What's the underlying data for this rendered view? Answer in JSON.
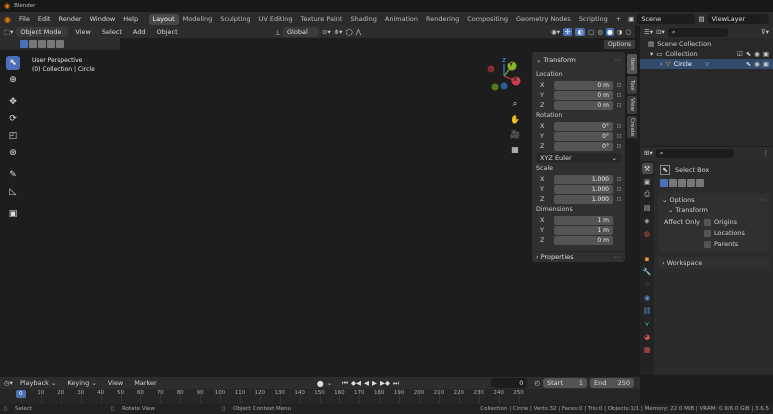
{
  "window": {
    "title": "Blender"
  },
  "menus": [
    "File",
    "Edit",
    "Render",
    "Window",
    "Help"
  ],
  "workspaces": [
    "Layout",
    "Modeling",
    "Sculpting",
    "UV Editing",
    "Texture Paint",
    "Shading",
    "Animation",
    "Rendering",
    "Compositing",
    "Geometry Nodes",
    "Scripting"
  ],
  "active_workspace": "Layout",
  "add_workspace": "+",
  "scene": {
    "name": "Scene",
    "view_layer": "ViewLayer"
  },
  "viewport_header": {
    "mode": "Object Mode",
    "menus": [
      "View",
      "Select",
      "Add",
      "Object"
    ],
    "transform_orientation": "Global",
    "options_label": "Options"
  },
  "viewport": {
    "view_name": "User Perspective",
    "collection_info": "(0) Collection | Circle",
    "gizmo": {
      "x": "X",
      "y": "Y",
      "z": "Z"
    }
  },
  "n_tabs": [
    "Item",
    "Tool",
    "View",
    "Create"
  ],
  "transform": {
    "title": "Transform",
    "location_label": "Location",
    "location": [
      {
        "axis": "X",
        "value": "0 m"
      },
      {
        "axis": "Y",
        "value": "0 m"
      },
      {
        "axis": "Z",
        "value": "0 m"
      }
    ],
    "rotation_label": "Rotation",
    "rotation": [
      {
        "axis": "X",
        "value": "0°"
      },
      {
        "axis": "Y",
        "value": "0°"
      },
      {
        "axis": "Z",
        "value": "0°"
      }
    ],
    "rotation_mode": "XYZ Euler",
    "scale_label": "Scale",
    "scale": [
      {
        "axis": "X",
        "value": "1.000"
      },
      {
        "axis": "Y",
        "value": "1.000"
      },
      {
        "axis": "Z",
        "value": "1.000"
      }
    ],
    "dimensions_label": "Dimensions",
    "dimensions": [
      {
        "axis": "X",
        "value": "1 m"
      },
      {
        "axis": "Y",
        "value": "1 m"
      },
      {
        "axis": "Z",
        "value": "0 m"
      }
    ],
    "properties_label": "Properties"
  },
  "outliner": {
    "items": [
      {
        "name": "Scene Collection"
      },
      {
        "name": "Collection"
      },
      {
        "name": "Circle"
      }
    ]
  },
  "properties": {
    "tool_name": "Select Box",
    "options_label": "Options",
    "transform_label": "Transform",
    "affect_only_label": "Affect Only",
    "affect_options": [
      "Origins",
      "Locations",
      "Parents"
    ],
    "workspace_label": "Workspace"
  },
  "timeline": {
    "menus": [
      "Playback",
      "Keying",
      "View",
      "Marker"
    ],
    "current_frame": "0",
    "start_label": "Start",
    "start": "1",
    "end_label": "End",
    "end": "250",
    "ticks": [
      "0",
      "10",
      "20",
      "30",
      "40",
      "50",
      "60",
      "70",
      "80",
      "90",
      "100",
      "110",
      "120",
      "130",
      "140",
      "150",
      "160",
      "170",
      "180",
      "190",
      "200",
      "210",
      "220",
      "230",
      "240",
      "250"
    ],
    "playhead_label": "0"
  },
  "statusbar": {
    "left": [
      "Select",
      "Rotate View",
      "Object Context Menu"
    ],
    "right": "Collection | Circle | Verts:32 | Faces:0 | Tris:0 | Objects:1/1 | Memory: 22.0 MiB | VRAM: 0.9/6.0 GiB | 3.6.5"
  },
  "colors": {
    "accent": "#4b72b8",
    "selection": "#ff9a1f",
    "x_axis": "#c33a45",
    "y_axis": "#7fae2a",
    "grid": "#444444",
    "viewport_bg": "#3d3d3d"
  }
}
